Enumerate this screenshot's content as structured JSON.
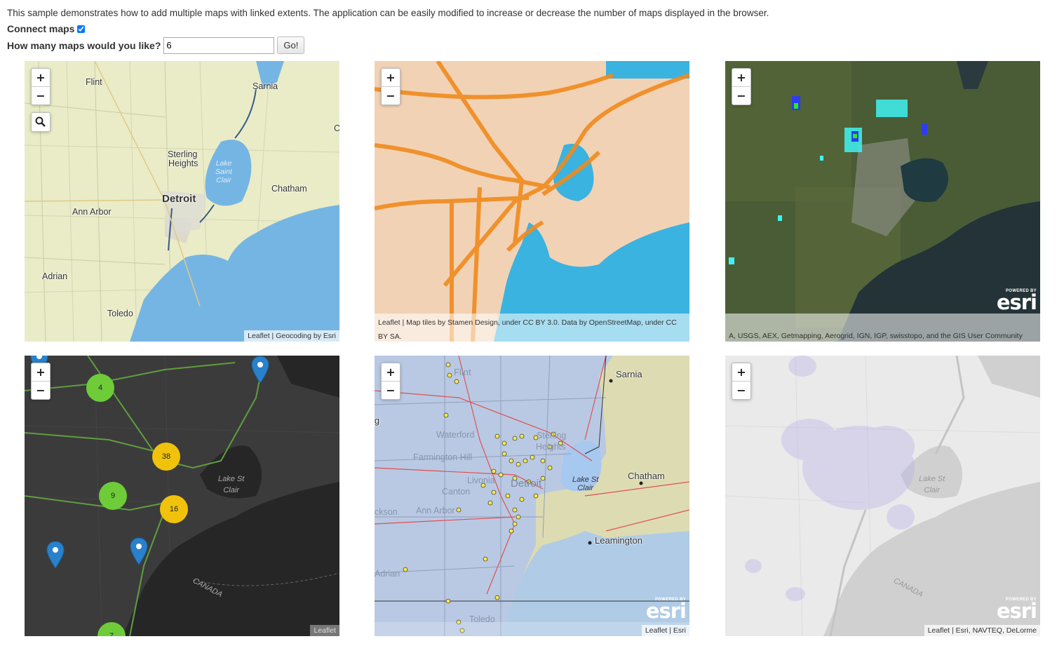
{
  "intro_text": "This sample demonstrates how to add multiple maps with linked extents. The application can be easily modified to increase or decrease the number of maps displayed in the browser.",
  "connect": {
    "label": "Connect maps",
    "checked": true
  },
  "count": {
    "label": "How many maps would you like?",
    "value": "6",
    "button": "Go!"
  },
  "zoom": {
    "in": "+",
    "out": "−"
  },
  "maps": [
    {
      "attribution": "Leaflet | Geocoding by Esri",
      "labels": {
        "flint": "Flint",
        "sarnia": "Sarnia",
        "sterling": "Sterling",
        "heights": "Heights",
        "lake1": "Lake",
        "lake2": "Saint",
        "lake3": "Clair",
        "detroit": "Detroit",
        "chatham": "Chatham",
        "annarbor": "Ann Arbor",
        "adrian": "Adrian",
        "toledo": "Toledo",
        "c": "C"
      }
    },
    {
      "attribution": "Leaflet | Map tiles by Stamen Design, under CC BY 3.0. Data by OpenStreetMap, under CC BY SA."
    },
    {
      "attribution": "A, USGS, AEX, Getmapping, Aerogrid, IGN, IGP, swisstopo, and the GIS User Community",
      "powered": "POWERED BY",
      "esri": "esri"
    },
    {
      "attribution": "Leaflet",
      "clusters": [
        "4",
        "38",
        "9",
        "16",
        "7"
      ],
      "labels": {
        "lake1": "Lake St",
        "lake2": "Clair",
        "canada": "CANADA"
      }
    },
    {
      "attribution": "Leaflet | Esri",
      "powered": "POWERED BY",
      "esri": "esri",
      "labels": {
        "flint": "Flint",
        "sarnia": "Sarnia",
        "g": "g",
        "waterford": "Waterford",
        "sterling": "Sterling",
        "heights": "Heights",
        "farmington": "Farmington Hill",
        "livonia": "Livonia",
        "canton": "Canton",
        "annarbor": "Ann Arbor",
        "ckson": "ckson",
        "detroit": "Detroit",
        "lake1": "Lake St",
        "lake2": "Clair",
        "chatham": "Chatham",
        "leamington": "Leamington",
        "adrian": "Adrian",
        "toledo": "Toledo"
      }
    },
    {
      "attribution": "Leaflet | Esri, NAVTEQ, DeLorme",
      "powered": "POWERED BY",
      "esri": "esri",
      "labels": {
        "lake1": "Lake St",
        "lake2": "Clair",
        "canada": "CANADA"
      }
    }
  ]
}
